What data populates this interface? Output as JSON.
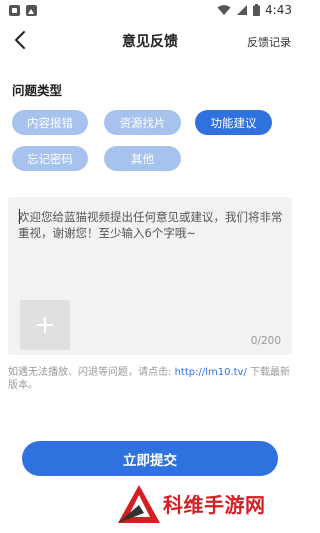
{
  "status_bar": {
    "time": "4:43",
    "icons": [
      "notification-icon",
      "gallery-icon",
      "wifi-icon",
      "signal-icon",
      "battery-icon"
    ]
  },
  "header": {
    "title": "意见反馈",
    "history_link": "反馈记录"
  },
  "issue_types": {
    "label": "问题类型",
    "options": [
      "内容报错",
      "资源找片",
      "功能建议",
      "忘记密码",
      "其他"
    ],
    "selected": "功能建议"
  },
  "feedback": {
    "placeholder": "欢迎您给蓝猫视频提出任何意见或建议，我们将非常重视，谢谢您！至少输入6个字哦~",
    "counter": "0/200"
  },
  "help": {
    "prefix": "如遇无法播放、闪退等问题，请点击: ",
    "link": "http://lm10.tv/",
    "suffix": " 下载最新版本。"
  },
  "submit": {
    "label": "立即提交"
  },
  "watermark": {
    "text": "科维手游网"
  },
  "colors": {
    "accent": "#2f72df",
    "chip_inactive": "#a7c3ed",
    "watermark": "#d41f23"
  }
}
